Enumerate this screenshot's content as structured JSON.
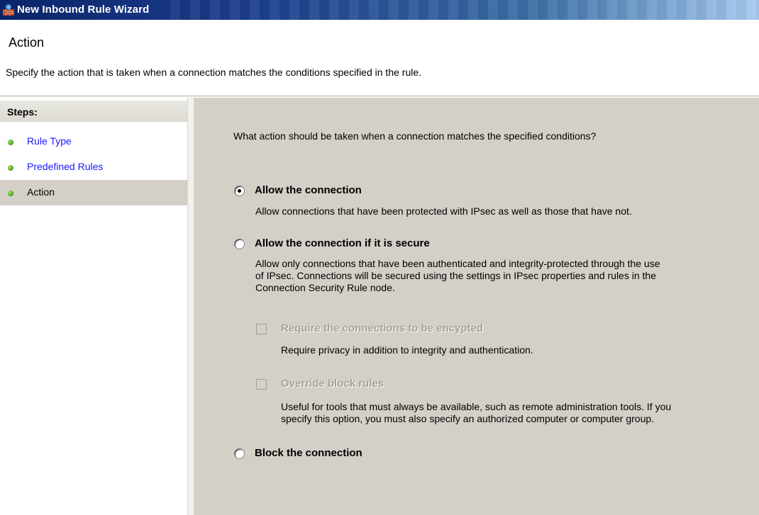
{
  "window": {
    "title": "New Inbound Rule Wizard"
  },
  "header": {
    "title": "Action",
    "subtitle": "Specify the action that is taken when a connection matches the conditions specified in the rule."
  },
  "sidebar": {
    "heading": "Steps:",
    "items": [
      {
        "label": "Rule Type",
        "active": false
      },
      {
        "label": "Predefined Rules",
        "active": false
      },
      {
        "label": "Action",
        "active": true
      }
    ]
  },
  "main": {
    "question": "What action should be taken when a connection matches the specified conditions?",
    "options": [
      {
        "label": "Allow the connection",
        "selected": true,
        "description": "Allow connections that have been protected with IPsec as well as those that have not."
      },
      {
        "label": "Allow the connection if it is secure",
        "selected": false,
        "description_lines": [
          "Allow only connections that have been authenticated and integrity-protected through the use",
          "of IPsec.  Connections will be secured using the settings in IPsec properties and rules in the",
          "Connection Security Rule node."
        ],
        "suboptions": [
          {
            "label": "Require the connections to be encypted",
            "checked": false,
            "disabled": true,
            "description": "Require privacy in addition to integrity and authentication."
          },
          {
            "label": "Override block rules",
            "checked": false,
            "disabled": true,
            "description_lines": [
              "Useful for tools that must always be available, such as remote administration tools.  If you",
              "specify this option, you must also specify an authorized computer or computer group."
            ]
          }
        ]
      },
      {
        "label": "Block the connection",
        "selected": false
      }
    ]
  },
  "colors": {
    "titlebar_start": "#0a246a",
    "link": "#1a1aff",
    "panel": "#d4d0c8",
    "disabled_text": "#a3a39c",
    "step_dot": "#3f9a1a"
  },
  "icons": {
    "title": "firewall-icon",
    "step_bullet": "green-dot-icon"
  }
}
